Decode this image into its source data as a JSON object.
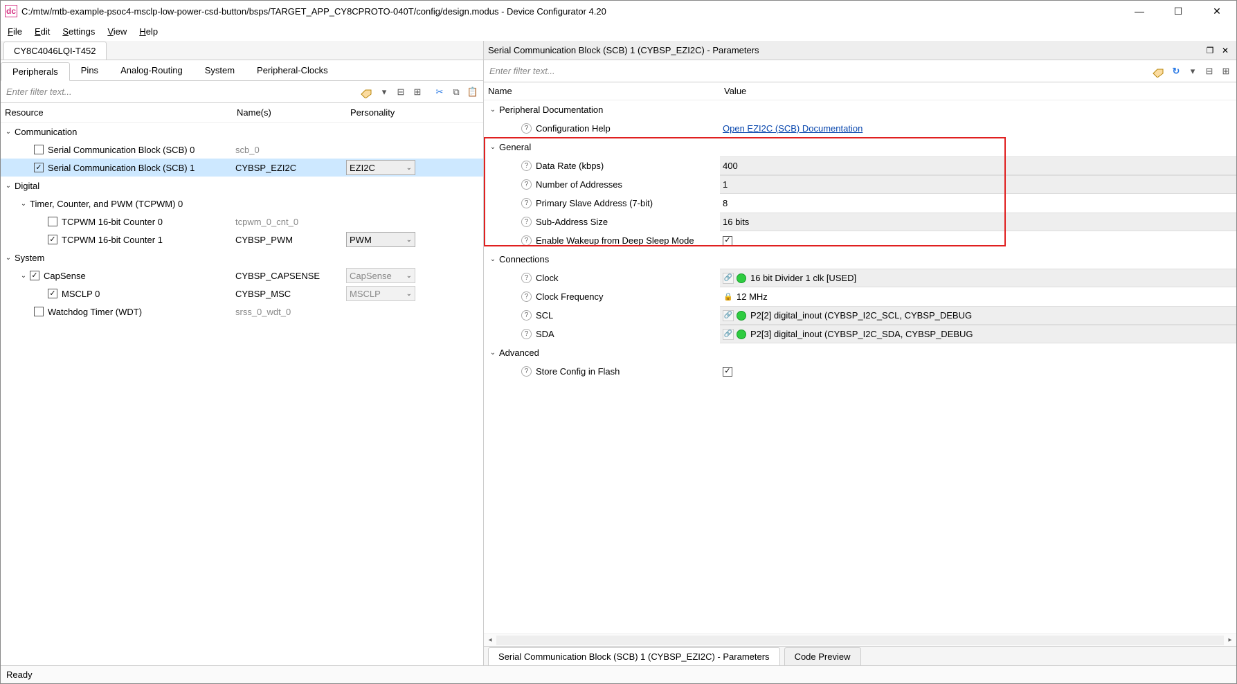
{
  "title": "C:/mtw/mtb-example-psoc4-msclp-low-power-csd-button/bsps/TARGET_APP_CY8CPROTO-040T/config/design.modus - Device Configurator 4.20",
  "menu": {
    "file": "File",
    "edit": "Edit",
    "settings": "Settings",
    "view": "View",
    "help": "Help"
  },
  "device_tab": "CY8C4046LQI-T452",
  "left_tabs": [
    "Peripherals",
    "Pins",
    "Analog-Routing",
    "System",
    "Peripheral-Clocks"
  ],
  "filter_placeholder": "Enter filter text...",
  "left_cols": {
    "resource": "Resource",
    "names": "Name(s)",
    "personality": "Personality"
  },
  "tree": {
    "comm": {
      "label": "Communication",
      "scb0": {
        "label": "Serial Communication Block (SCB) 0",
        "name": "scb_0"
      },
      "scb1": {
        "label": "Serial Communication Block (SCB) 1",
        "name": "CYBSP_EZI2C",
        "pers": "EZI2C"
      }
    },
    "digital": {
      "label": "Digital",
      "tcpwm": {
        "label": "Timer, Counter, and PWM (TCPWM) 0",
        "cnt0": {
          "label": "TCPWM 16-bit Counter 0",
          "name": "tcpwm_0_cnt_0"
        },
        "cnt1": {
          "label": "TCPWM 16-bit Counter 1",
          "name": "CYBSP_PWM",
          "pers": "PWM"
        }
      }
    },
    "system": {
      "label": "System",
      "capsense": {
        "label": "CapSense",
        "name": "CYBSP_CAPSENSE",
        "pers": "CapSense",
        "msclp0": {
          "label": "MSCLP 0",
          "name": "CYBSP_MSC",
          "pers": "MSCLP"
        }
      },
      "wdt": {
        "label": "Watchdog Timer (WDT)",
        "name": "srss_0_wdt_0"
      }
    }
  },
  "right": {
    "header": "Serial Communication Block (SCB) 1 (CYBSP_EZI2C) - Parameters",
    "filter_placeholder": "Enter filter text...",
    "cols": {
      "name": "Name",
      "value": "Value"
    },
    "sections": {
      "doc": {
        "label": "Peripheral Documentation",
        "cfg_help": {
          "label": "Configuration Help",
          "value": "Open EZI2C (SCB) Documentation"
        }
      },
      "general": {
        "label": "General",
        "data_rate": {
          "label": "Data Rate (kbps)",
          "value": "400"
        },
        "num_addr": {
          "label": "Number of Addresses",
          "value": "1"
        },
        "prim_addr": {
          "label": "Primary Slave Address (7-bit)",
          "value": "8"
        },
        "sub_size": {
          "label": "Sub-Address Size",
          "value": "16 bits"
        },
        "wakeup": {
          "label": "Enable Wakeup from Deep Sleep Mode"
        }
      },
      "conn": {
        "label": "Connections",
        "clock": {
          "label": "Clock",
          "value": "16 bit Divider 1 clk [USED]"
        },
        "freq": {
          "label": "Clock Frequency",
          "value": "12 MHz"
        },
        "scl": {
          "label": "SCL",
          "value": "P2[2] digital_inout (CYBSP_I2C_SCL, CYBSP_DEBUG"
        },
        "sda": {
          "label": "SDA",
          "value": "P2[3] digital_inout (CYBSP_I2C_SDA, CYBSP_DEBUG"
        }
      },
      "adv": {
        "label": "Advanced",
        "store": {
          "label": "Store Config in Flash"
        }
      }
    },
    "bottom_tabs": {
      "params": "Serial Communication Block (SCB) 1 (CYBSP_EZI2C) - Parameters",
      "code": "Code Preview"
    }
  },
  "status": "Ready"
}
